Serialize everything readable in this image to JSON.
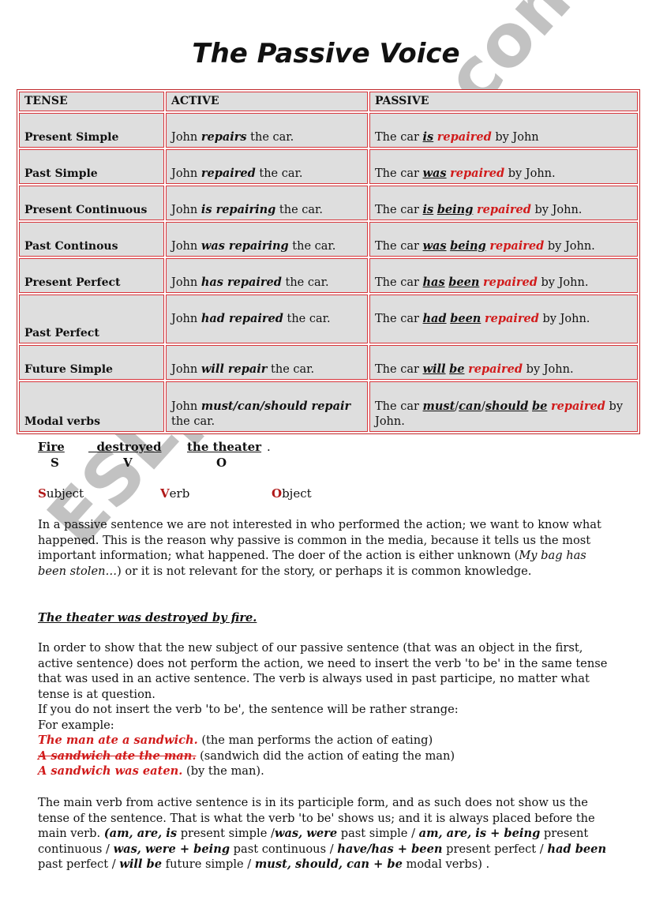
{
  "title": "The Passive Voice",
  "table": {
    "headers": [
      "TENSE",
      "ACTIVE",
      "PASSIVE"
    ],
    "rows": [
      {
        "tense": "Present Simple",
        "active": [
          {
            "t": "John "
          },
          {
            "t": "repairs",
            "s": "bi"
          },
          {
            "t": " the car."
          }
        ],
        "passive": [
          {
            "t": "The car "
          },
          {
            "t": "is",
            "s": "biu"
          },
          {
            "t": " "
          },
          {
            "t": "repaired",
            "s": "redbi"
          },
          {
            "t": " by John"
          }
        ]
      },
      {
        "tense": "Past Simple",
        "active": [
          {
            "t": "John "
          },
          {
            "t": "repaired",
            "s": "bi"
          },
          {
            "t": " the car."
          }
        ],
        "passive": [
          {
            "t": "The car "
          },
          {
            "t": "was",
            "s": "biu"
          },
          {
            "t": " "
          },
          {
            "t": "repaired",
            "s": "redbi"
          },
          {
            "t": " by John."
          }
        ]
      },
      {
        "tense": "Present Continuous",
        "active": [
          {
            "t": "John "
          },
          {
            "t": "is repairing",
            "s": "bi"
          },
          {
            "t": " the car."
          }
        ],
        "passive": [
          {
            "t": "The car "
          },
          {
            "t": "is",
            "s": "biu"
          },
          {
            "t": " "
          },
          {
            "t": "being",
            "s": "biu"
          },
          {
            "t": " "
          },
          {
            "t": "repaired",
            "s": "redbi"
          },
          {
            "t": " by John."
          }
        ]
      },
      {
        "tense": "Past Continous",
        "active": [
          {
            "t": "John "
          },
          {
            "t": "was repairing",
            "s": "bi"
          },
          {
            "t": " the car."
          }
        ],
        "passive": [
          {
            "t": "The car "
          },
          {
            "t": "was",
            "s": "biu"
          },
          {
            "t": " "
          },
          {
            "t": "being",
            "s": "biu"
          },
          {
            "t": " "
          },
          {
            "t": "repaired",
            "s": "redbi"
          },
          {
            "t": " by John."
          }
        ]
      },
      {
        "tense": "Present Perfect",
        "active": [
          {
            "t": "John "
          },
          {
            "t": "has repaired",
            "s": "bi"
          },
          {
            "t": " the car."
          }
        ],
        "passive": [
          {
            "t": "The car "
          },
          {
            "t": "has",
            "s": "biu"
          },
          {
            "t": " "
          },
          {
            "t": "been",
            "s": "biu"
          },
          {
            "t": " "
          },
          {
            "t": "repaired",
            "s": "redbi"
          },
          {
            "t": " by John."
          }
        ]
      },
      {
        "tense": "Past Perfect",
        "active": [
          {
            "t": "John "
          },
          {
            "t": "had repaired",
            "s": "bi"
          },
          {
            "t": " the car."
          }
        ],
        "passive": [
          {
            "t": "The car "
          },
          {
            "t": "had",
            "s": "biu"
          },
          {
            "t": " "
          },
          {
            "t": "been",
            "s": "biu"
          },
          {
            "t": " "
          },
          {
            "t": "repaired",
            "s": "redbi"
          },
          {
            "t": " by John."
          }
        ]
      },
      {
        "tense": "Future Simple",
        "active": [
          {
            "t": "John "
          },
          {
            "t": "will repair",
            "s": "bi"
          },
          {
            "t": " the car."
          }
        ],
        "passive": [
          {
            "t": "The car "
          },
          {
            "t": "will",
            "s": "biu"
          },
          {
            "t": " "
          },
          {
            "t": "be",
            "s": "biu"
          },
          {
            "t": " "
          },
          {
            "t": "repaired",
            "s": "redbi"
          },
          {
            "t": " by John."
          }
        ]
      },
      {
        "tense": "Modal verbs",
        "active": [
          {
            "t": "John "
          },
          {
            "t": "must/can/should repair",
            "s": "bi"
          },
          {
            "t": " the car."
          }
        ],
        "passive": [
          {
            "t": "The car "
          },
          {
            "t": "must",
            "s": "biu"
          },
          {
            "t": "/"
          },
          {
            "t": "can",
            "s": "biu"
          },
          {
            "t": "/"
          },
          {
            "t": "should",
            "s": "biu"
          },
          {
            "t": " "
          },
          {
            "t": "be",
            "s": "biu"
          },
          {
            "t": " "
          },
          {
            "t": "repaired",
            "s": "redbi"
          },
          {
            "t": " by John."
          }
        ]
      }
    ]
  },
  "svo": {
    "words": [
      "Fire",
      "  destroyed",
      "the theater"
    ],
    "period": ".",
    "letters": [
      "S",
      "V",
      "O"
    ],
    "legend": [
      {
        "initial": "S",
        "rest": "ubject"
      },
      {
        "initial": "V",
        "rest": "erb"
      },
      {
        "initial": "O",
        "rest": "bject"
      }
    ]
  },
  "paragraph1": [
    {
      "t": "In a passive sentence we are not interested in who performed the action; we want to know what happened. This is the reason why passive is common in the media, because it tells us the most important information; what happened. The doer of the action is either unknown ("
    },
    {
      "t": "My bag has been stolen…",
      "s": "i"
    },
    {
      "t": ") or it is not relevant for the story, or perhaps it is common knowledge."
    }
  ],
  "example_heading": "The theater was destroyed by fire.",
  "paragraph2": "In order to show that the new subject of our passive sentence (that was an object in the first, active sentence) does not perform the action, we need to insert the verb 'to be' in the same tense that was used in an active sentence. The verb is always used in past participe, no matter what tense is at question.",
  "paragraph2b": "If you do not insert the verb 'to be', the sentence will be rather strange:",
  "for_example": "For example:",
  "examples": [
    {
      "sentence": "The man ate a sandwich.",
      "note": " (the man performs the action of eating)",
      "strike": false
    },
    {
      "sentence": "A sandwich ate the man.",
      "note": " (sandwich did the action of eating the man)",
      "strike": true
    },
    {
      "sentence": "A sandwich was eaten.",
      "note": " (by the man).",
      "strike": false
    }
  ],
  "paragraph3": [
    {
      "t": "The main verb from active sentence is in its participle form, and as such does not show us the tense of the sentence. That is what the verb 'to be' shows us; and it is always placed before the main verb. "
    },
    {
      "t": "(am, are, is",
      "s": "bi"
    },
    {
      "t": " present simple /"
    },
    {
      "t": "was, were",
      "s": "bi"
    },
    {
      "t": " past simple / "
    },
    {
      "t": "am, are, is + being",
      "s": "bi"
    },
    {
      "t": "  present continuous / "
    },
    {
      "t": "was, were + being",
      "s": "bi"
    },
    {
      "t": " past continuous / "
    },
    {
      "t": "have/has + been",
      "s": "bi"
    },
    {
      "t": " present perfect / "
    },
    {
      "t": "had been",
      "s": "bi"
    },
    {
      "t": " past perfect / "
    },
    {
      "t": "will be",
      "s": "bi"
    },
    {
      "t": " future simple / "
    },
    {
      "t": "must, should, can + be",
      "s": "bi"
    },
    {
      "t": " modal verbs) ."
    }
  ],
  "watermark": "ESLprintables.com",
  "colors": {
    "accent_red": "#d11b1b",
    "table_border": "#d8353b",
    "cell_bg": "#dedede"
  }
}
